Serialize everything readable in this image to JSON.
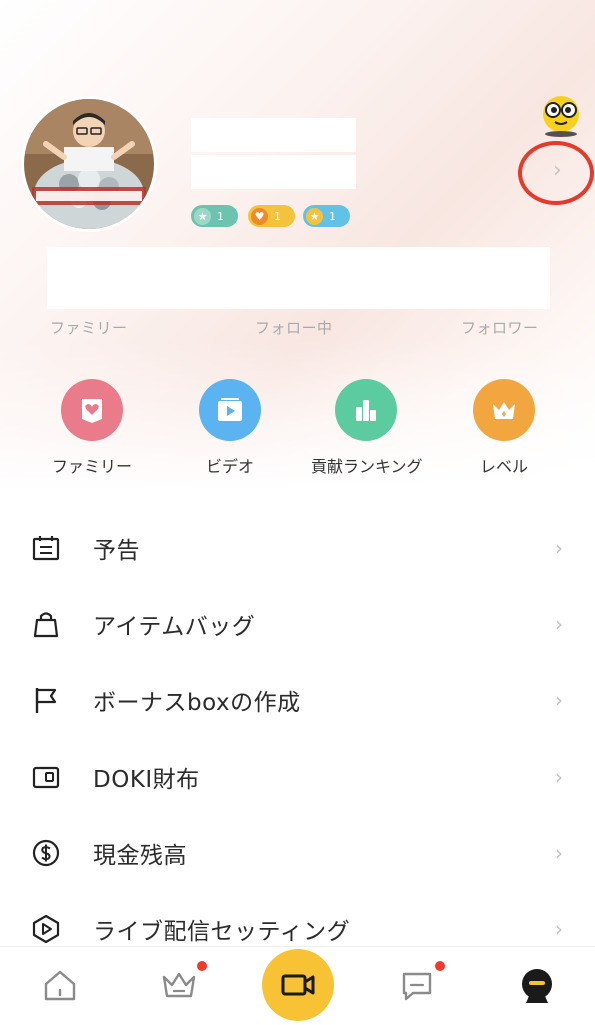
{
  "profile": {
    "badges": [
      {
        "icon": "star-icon",
        "value": "1",
        "color": "#6cc4ae"
      },
      {
        "icon": "heart-icon",
        "value": "1",
        "color": "#f5c23c"
      },
      {
        "icon": "star-icon",
        "value": "1",
        "color": "#62c1e6"
      }
    ],
    "detail_chevron": "›"
  },
  "stats": {
    "labels": [
      "ファミリー",
      "フォロー中",
      "フォロワー"
    ]
  },
  "quick_actions": [
    {
      "label": "ファミリー",
      "icon": "family-icon",
      "color": "#e97b8a"
    },
    {
      "label": "ビデオ",
      "icon": "video-icon",
      "color": "#5bb3ef"
    },
    {
      "label": "貢献ランキング",
      "icon": "ranking-icon",
      "color": "#5ccb9f"
    },
    {
      "label": "レベル",
      "icon": "level-crown-icon",
      "color": "#f2a640"
    }
  ],
  "menu": [
    {
      "label": "予告",
      "icon": "calendar-icon"
    },
    {
      "label": "アイテムバッグ",
      "icon": "bag-icon"
    },
    {
      "label": "ボーナスboxの作成",
      "icon": "flag-icon"
    },
    {
      "label": "DOKI財布",
      "icon": "wallet-icon"
    },
    {
      "label": "現金残高",
      "icon": "dollar-icon"
    },
    {
      "label": "ライブ配信セッティング",
      "icon": "play-hexagon-icon"
    }
  ],
  "menu_chevron": "›",
  "tabbar": {
    "items": [
      {
        "icon": "home-icon"
      },
      {
        "icon": "crown-icon",
        "notification": true
      },
      {
        "icon": "camera-icon",
        "accent": "#f7c233"
      },
      {
        "icon": "chat-icon",
        "notification": true
      },
      {
        "icon": "profile-mascot-icon"
      }
    ]
  },
  "colors": {
    "accent_yellow": "#f7c233",
    "highlight_red": "#e53a2b",
    "notification_red": "#f2392c"
  }
}
